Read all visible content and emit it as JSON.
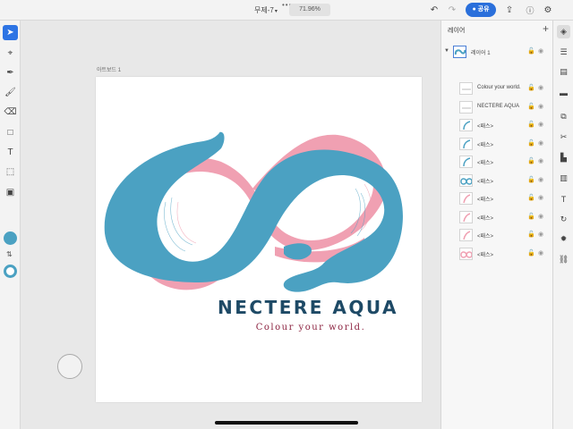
{
  "topbar": {
    "title": "무제-7",
    "zoom": "71.96%",
    "share_label": "공유",
    "icons": [
      "undo-icon",
      "redo-icon",
      "export-icon",
      "help-icon",
      "settings-icon"
    ]
  },
  "left_tools": [
    "select-tool",
    "direct-select-tool",
    "pen-tool",
    "brush-tool",
    "eraser-tool",
    "rectangle-tool",
    "text-tool",
    "shape-tool",
    "image-tool"
  ],
  "colors": {
    "fill": "#4ba1c2",
    "stroke": "#4ba1c2",
    "blue": "#4ba1c2",
    "pink": "#f0a0b2",
    "brand_text": "#1e4a66",
    "tagline_text": "#8c2340",
    "accent": "#2d74e4"
  },
  "artboard": {
    "label": "아트보드 1",
    "brand": "NECTERE AQUA",
    "tagline": "Colour your world."
  },
  "layers_panel": {
    "title": "레이어",
    "group_name": "레이어 1",
    "items": [
      {
        "name": "Colour your world.",
        "thumb": "text"
      },
      {
        "name": "NECTERE AQUA",
        "thumb": "text"
      },
      {
        "name": "<패스>",
        "thumb": "blue-curve"
      },
      {
        "name": "<패스>",
        "thumb": "blue-curve"
      },
      {
        "name": "<패스>",
        "thumb": "blue-curve"
      },
      {
        "name": "<패스>",
        "thumb": "blue-infinity"
      },
      {
        "name": "<패스>",
        "thumb": "pink-curve"
      },
      {
        "name": "<패스>",
        "thumb": "pink-curve"
      },
      {
        "name": "<패스>",
        "thumb": "pink-curve"
      },
      {
        "name": "<패스>",
        "thumb": "pink-infinity"
      }
    ]
  },
  "right_strip": [
    "layers-icon",
    "properties-icon",
    "libraries-icon",
    "comments-icon",
    "pathfinder-icon",
    "scissors-icon",
    "align-icon",
    "type-icon",
    "transform-icon",
    "settings-icon",
    "link-icon"
  ]
}
